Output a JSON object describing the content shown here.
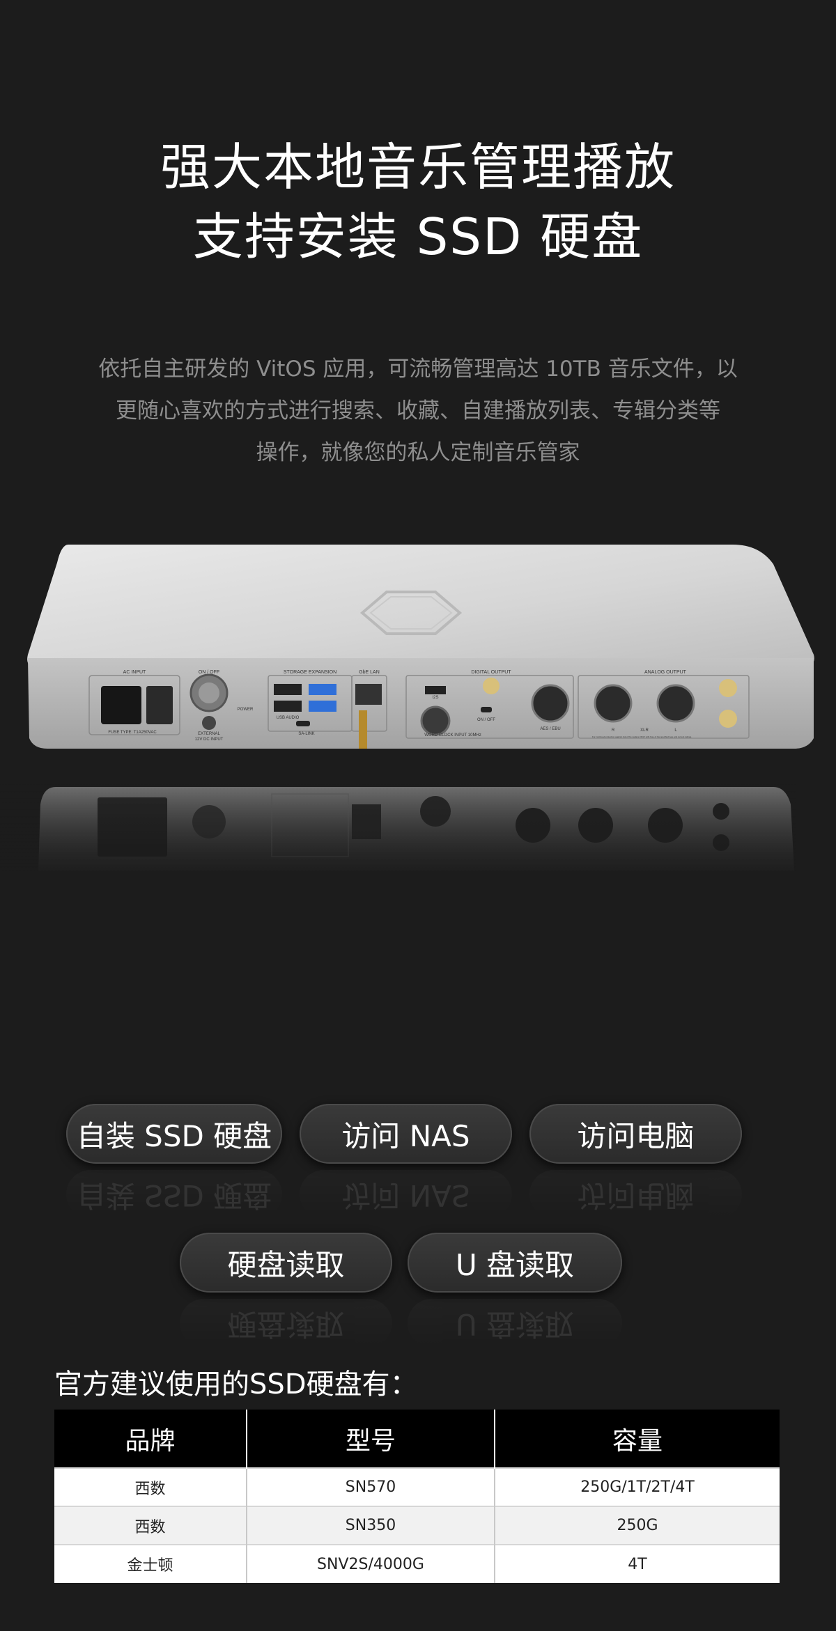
{
  "headline": {
    "line1": "强大本地音乐管理播放",
    "line2": "支持安装 SSD 硬盘"
  },
  "description": {
    "line1": "依托自主研发的 VitOS 应用，可流畅管理高达 10TB 音乐文件，以",
    "line2": "更随心喜欢的方式进行搜索、收藏、自建播放列表、专辑分类等",
    "line3": "操作，就像您的私人定制音乐管家"
  },
  "device_panel": {
    "ac_input": "AC INPUT",
    "on_off": "ON / OFF",
    "storage_expansion": "STORAGE EXPANSION",
    "gbe_lan": "GbE LAN",
    "digital_output": "DIGITAL OUTPUT",
    "analog_output": "ANALOG OUTPUT",
    "usb_audio": "USB AUDIO",
    "sa_link": "SA-LINK",
    "external": "EXTERNAL",
    "dc_input": "12V DC INPUT",
    "power": "POWER",
    "fuse": "FUSE TYPE: T1A250VAC",
    "word_clock": "WORD CLOCK INPUT 10MHz",
    "aes_ebu": "AES / EBU",
    "xlr": "XLR",
    "r": "R",
    "l": "L",
    "i2s": "I2S",
    "on_off_small": "ON / OFF",
    "warning": "For continued protection against risk of fire replace ONLY with fuse of the specified type and current ratings."
  },
  "features": {
    "row1": [
      "自装 SSD 硬盘",
      "访问 NAS",
      "访问电脑"
    ],
    "row2": [
      "硬盘读取",
      "U 盘读取"
    ]
  },
  "ssd_section": {
    "title": "官方建议使用的SSD硬盘有：",
    "headers": [
      "品牌",
      "型号",
      "容量"
    ],
    "rows": [
      [
        "西数",
        "SN570",
        "250G/1T/2T/4T"
      ],
      [
        "西数",
        "SN350",
        "250G"
      ],
      [
        "金士顿",
        "SNV2S/4000G",
        "4T"
      ]
    ]
  },
  "colors": {
    "background": "#1c1c1c",
    "description_text": "#8e8e8e",
    "table_header": "#000000",
    "pill": "#333333"
  }
}
